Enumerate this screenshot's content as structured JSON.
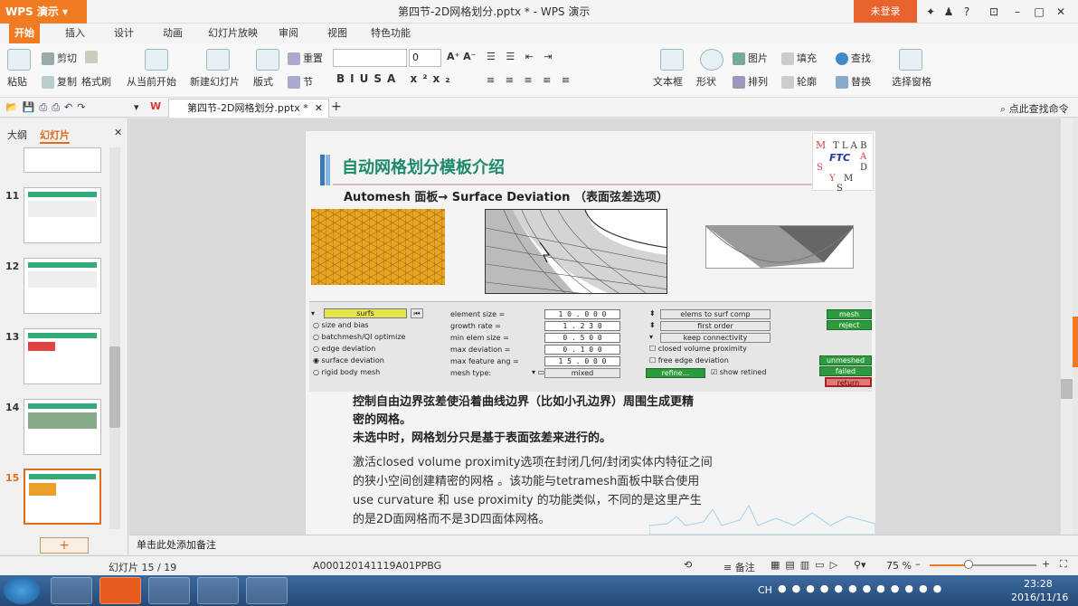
{
  "app": {
    "menu_label": "WPS 演示",
    "title": "第四节-2D网格划分.pptx * - WPS 演示",
    "login": "未登录",
    "help": "?"
  },
  "tabs": [
    "开始",
    "插入",
    "设计",
    "动画",
    "幻灯片放映",
    "审阅",
    "视图",
    "特色功能"
  ],
  "ribbon": {
    "paste": "粘贴",
    "cut": "剪切",
    "copy": "复制",
    "format_painter": "格式刷",
    "from_current": "从当前开始",
    "new_slide": "新建幻灯片",
    "layout": "版式",
    "reset": "重置",
    "section": "节",
    "font_size": "0",
    "textbox": "文本框",
    "shape": "形状",
    "picture": "图片",
    "fill": "填充",
    "arrange": "排列",
    "outline": "轮廓",
    "find": "查找",
    "replace": "替换",
    "select_pane": "选择窗格"
  },
  "quickbar": {
    "doc_tab": "第四节-2D网格划分.pptx *",
    "search": "点此查找命令"
  },
  "leftpanel": {
    "tab_outline": "大纲",
    "tab_slides": "幻灯片",
    "slide_numbers": [
      "11",
      "12",
      "13",
      "14",
      "15"
    ]
  },
  "slide": {
    "title": "自动网格划分模板介绍",
    "subtitle": "Automesh 面板→ Surface Deviation （表面弦差选项）",
    "logo": {
      "brand": "FTC"
    },
    "panel": {
      "surfs": "surfs",
      "options": [
        "size and bias",
        "batchmesh/QI optimize",
        "edge deviation",
        "surface deviation",
        "rigid body mesh"
      ],
      "labels": [
        "element size =",
        "growth rate =",
        "min elem size =",
        "max deviation =",
        "max feature ang =",
        "mesh type:"
      ],
      "values": [
        "1 0 . 0 0 0",
        "1 . 2 3 0",
        "0 . 5 0 0",
        "0 . 1 0 0",
        "1 5 . 0 0 0"
      ],
      "mesh_type": "mixed",
      "right_buttons": [
        "elems to surf comp",
        "first order",
        "keep connectivity"
      ],
      "checks": [
        "closed volume proximity",
        "free edge deviation"
      ],
      "refine": "refine...",
      "show_retined": "show retined",
      "mesh": "mesh",
      "reject": "reject",
      "unmeshed": "unmeshed",
      "failed": "failed",
      "return": "return"
    },
    "body": [
      "控制自由边界弦差使沿着曲线边界（比如小孔边界）周围生成更精",
      "密的网格。",
      "未选中时，网格划分只是基于表面弦差来进行的。"
    ],
    "para2": [
      "激活closed volume proximity选项在封闭几何/封闭实体内特征之间",
      "的狭小空间创建精密的网格 。该功能与tetramesh面板中联合使用",
      "use curvature 和 use proximity 的功能类似，不同的是这里产生",
      "的是2D面网格而不是3D四面体网格。"
    ]
  },
  "notes": "单击此处添加备注",
  "status": {
    "slide_info": "幻灯片 15 / 19",
    "template": "A000120141119A01PPBG",
    "notes_btn": "备注",
    "zoom": "75 %"
  },
  "taskbar": {
    "lang": "CH",
    "time": "23:28",
    "date": "2016/11/16"
  }
}
